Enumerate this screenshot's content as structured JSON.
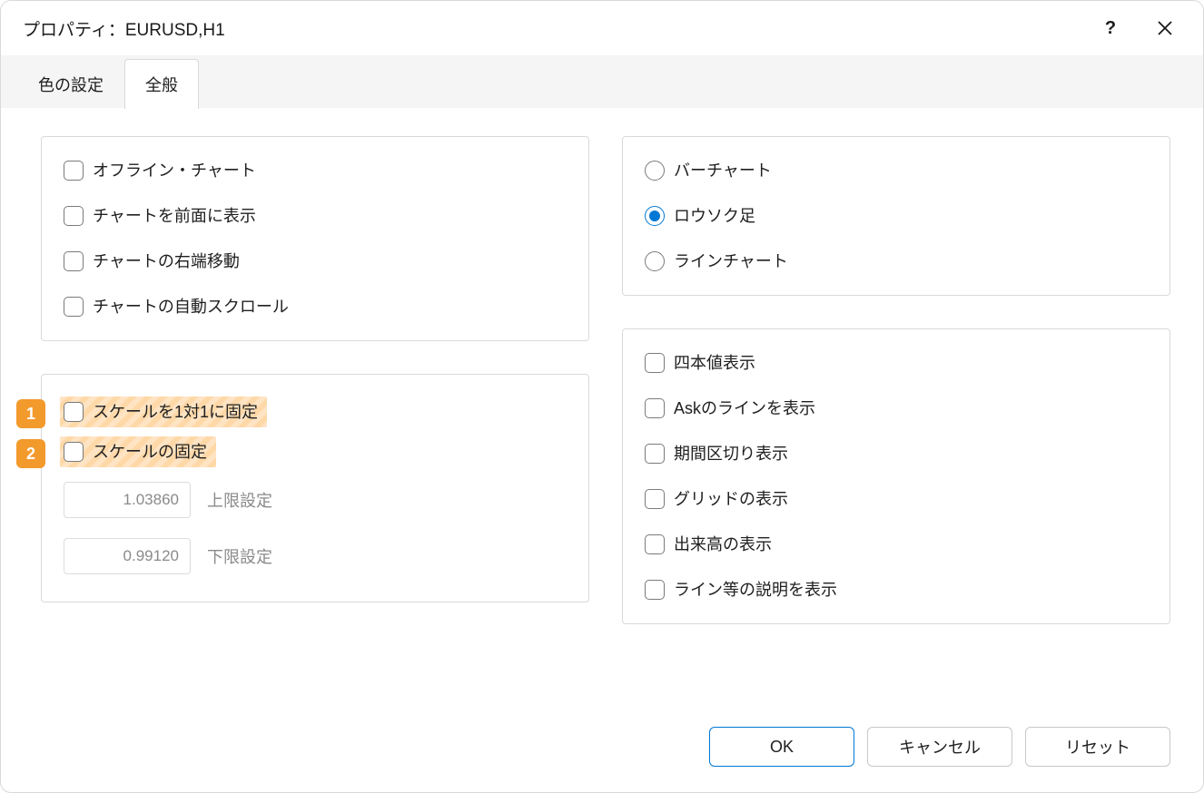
{
  "title": "プロパティ：EURUSD,H1",
  "tabs": {
    "colors": "色の設定",
    "general": "全般"
  },
  "left_panel1": {
    "offline": "オフライン・チャート",
    "front": "チャートを前面に表示",
    "rightshift": "チャートの右端移動",
    "autoscroll": "チャートの自動スクロール"
  },
  "left_panel2": {
    "badge1": "1",
    "badge2": "2",
    "fix1to1": "スケールを1対1に固定",
    "fixscale": "スケールの固定",
    "upper_val": "1.03860",
    "upper_label": "上限設定",
    "lower_val": "0.99120",
    "lower_label": "下限設定"
  },
  "right_panel1": {
    "bar": "バーチャート",
    "candle": "ロウソク足",
    "line": "ラインチャート"
  },
  "right_panel2": {
    "ohlc": "四本値表示",
    "ask": "Askのラインを表示",
    "period": "期間区切り表示",
    "grid": "グリッドの表示",
    "volume": "出来高の表示",
    "descr": "ライン等の説明を表示"
  },
  "buttons": {
    "ok": "OK",
    "cancel": "キャンセル",
    "reset": "リセット"
  }
}
